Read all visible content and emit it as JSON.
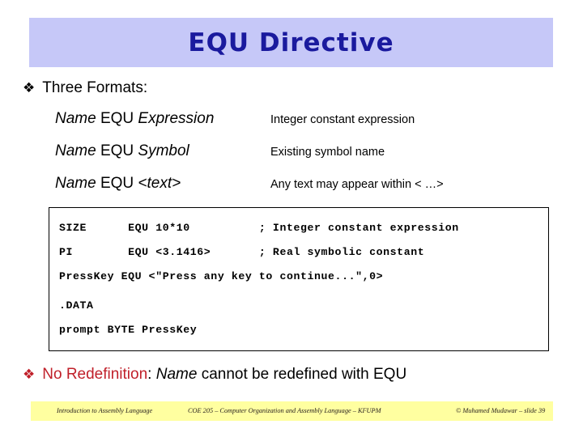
{
  "slide": {
    "title": "EQU Directive",
    "title_band_color": "#c6c8f8",
    "title_text_color": "#1a1a9e"
  },
  "bullets": {
    "three_formats": {
      "marker": "diamond-bullet-icon",
      "marker_glyph": "❖",
      "text": "Three Formats:"
    },
    "no_redefinition": {
      "marker": "diamond-bullet-icon",
      "marker_glyph": "❖",
      "label": "No Redefinition",
      "label_color": "#c0202a",
      "rest_prefix": ": ",
      "rest_italic": "Name",
      "rest_suffix": " cannot be redefined with EQU"
    }
  },
  "formats": [
    {
      "name": "Name",
      "keyword": " EQU ",
      "operand": "Expression",
      "description": "Integer constant expression"
    },
    {
      "name": "Name",
      "keyword": " EQU ",
      "operand": "Symbol",
      "description": "Existing symbol name"
    },
    {
      "name": "Name",
      "keyword": " EQU ",
      "operand": "<text>",
      "description": "Any text may appear within < …>"
    }
  ],
  "code_box": {
    "lines": [
      "SIZE      EQU 10*10          ; Integer constant expression",
      "PI        EQU <3.1416>       ; Real symbolic constant",
      "PressKey EQU <\"Press any key to continue...\",0>",
      ".DATA",
      "prompt BYTE PressKey"
    ]
  },
  "footer": {
    "band_color": "#ffffa0",
    "left": "Introduction to Assembly Language",
    "center": "COE 205 – Computer Organization and Assembly Language – KFUPM",
    "right": "© Muhamed Mudawar – slide 39"
  }
}
